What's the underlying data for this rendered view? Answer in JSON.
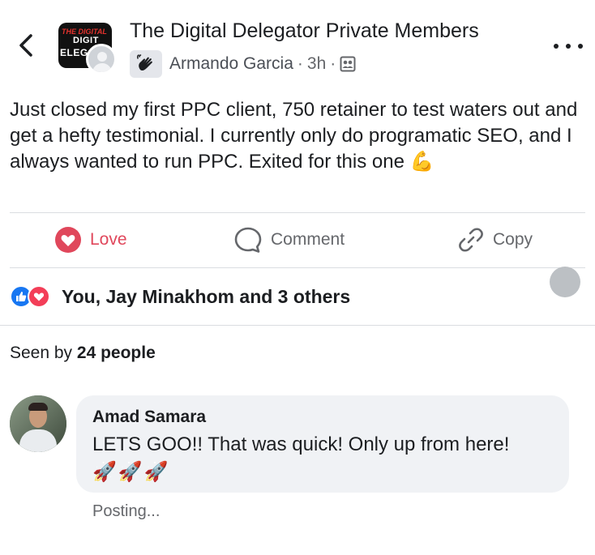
{
  "header": {
    "back_label": "back",
    "group_name": "The Digital Delegator Private Members",
    "group_logo_lines": [
      "THE DIGITAL",
      "DIGIT",
      "ELEG"
    ],
    "author": "Armando Garcia",
    "separator": "·",
    "time": "3h",
    "audience_icon": "members-group-icon",
    "badge_icon": "waving-hand-badge-icon",
    "more_icon": "more-horizontal-icon"
  },
  "post": {
    "text": "Just closed my first PPC client, 750 retainer to test waters out and get a hefty testimonial. I currently only do programatic SEO, and I always wanted to run PPC. Exited for this one",
    "emoji": "💪"
  },
  "actions": {
    "love": "Love",
    "comment": "Comment",
    "copy": "Copy"
  },
  "reactions": {
    "summary": "You, Jay Minakhom and 3 others",
    "types": [
      "like",
      "love"
    ]
  },
  "seen": {
    "prefix": "Seen by",
    "count": "24 people"
  },
  "comment": {
    "author": "Amad Samara",
    "text": "LETS GOO!! That was quick! Only up from here!",
    "emoji": "🚀🚀🚀",
    "status": "Posting..."
  },
  "colors": {
    "love": "#e0475b",
    "like_blue": "#1877f2",
    "text_primary": "#1c1e21",
    "text_secondary": "#65676b",
    "bubble_bg": "#f0f2f5",
    "divider": "#dadde1"
  }
}
